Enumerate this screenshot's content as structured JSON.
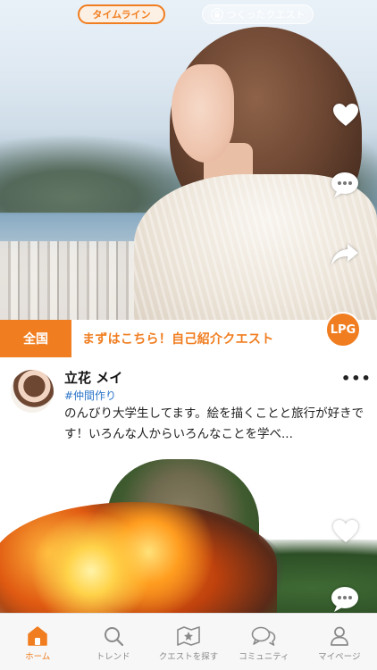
{
  "top_tabs": {
    "timeline": "タイムライン",
    "created_quests": "つくったクエスト"
  },
  "post": {
    "region_label": "全国",
    "quest_title": "まずはこちら！自己紹介クエスト",
    "badge_logo": "LPG",
    "user": {
      "name": "立花 メイ",
      "tag": "#仲間作り",
      "bio": "のんびり大学生してます。絵を描くことと旅行が好きです！いろんな人からいろんなことを学べ..."
    },
    "more_label": "•••"
  },
  "side_actions": [
    "heart-icon",
    "comment-icon",
    "share-icon"
  ],
  "bottom_nav": {
    "items": [
      {
        "label": "ホーム",
        "icon": "home-icon",
        "active": true
      },
      {
        "label": "トレンド",
        "icon": "search-icon",
        "active": false
      },
      {
        "label": "クエストを探す",
        "icon": "map-icon",
        "active": false
      },
      {
        "label": "コミュニティ",
        "icon": "chat-icon",
        "active": false
      },
      {
        "label": "マイページ",
        "icon": "person-icon",
        "active": false
      }
    ]
  },
  "colors": {
    "accent": "#f07d1f",
    "tag_blue": "#2a74c9",
    "nav_inactive": "#8a8a8a"
  }
}
